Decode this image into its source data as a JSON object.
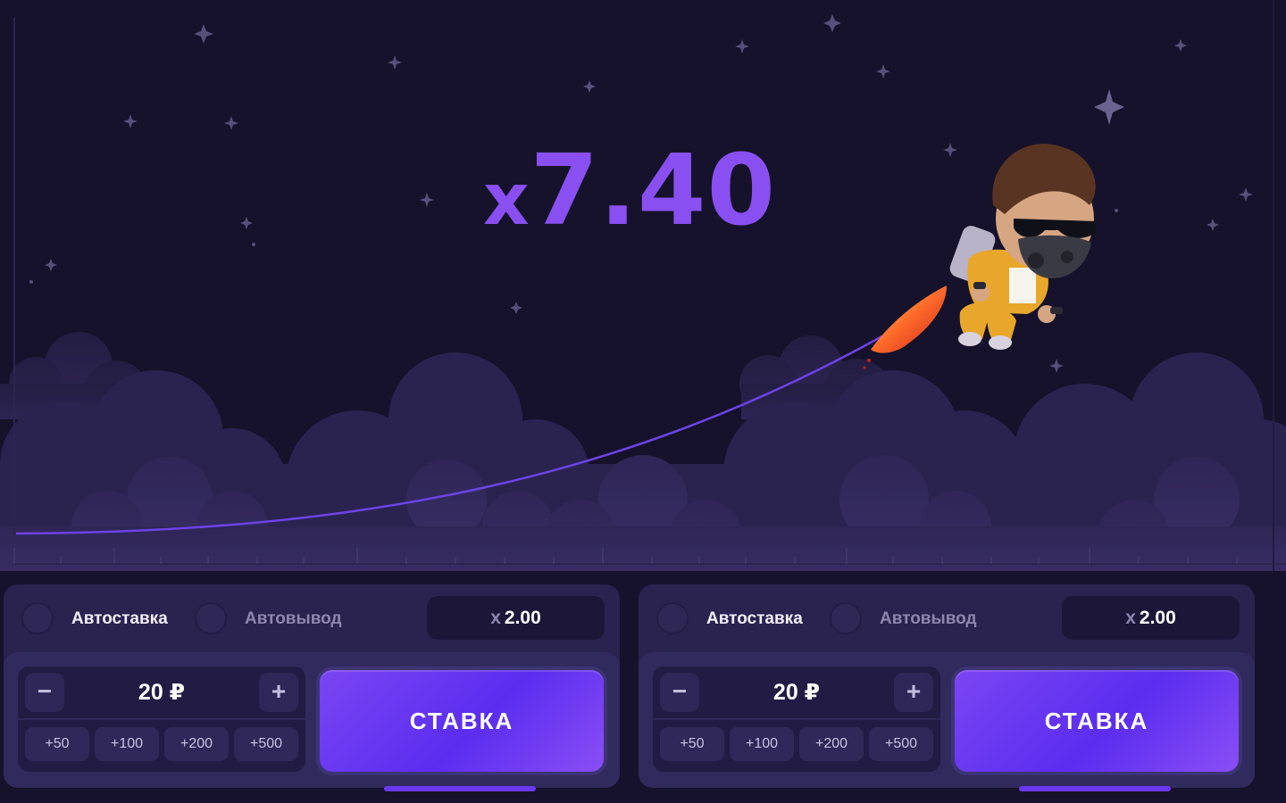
{
  "game": {
    "multiplier_prefix": "x",
    "multiplier_value": "7.40",
    "accent_color": "#8a4ff0",
    "curve_color": "#6b44e8",
    "background_color": "#16122b",
    "character_icon": "jetpack-pilot-icon"
  },
  "panels": [
    {
      "autobet_label": "Автоставка",
      "autocashout_label": "Автовывод",
      "cashout_prefix": "x",
      "cashout_value": "2.00",
      "stake_value": "20 ₽",
      "minus_symbol": "−",
      "plus_symbol": "+",
      "quick_amounts": [
        "+50",
        "+100",
        "+200",
        "+500"
      ],
      "bet_label": "СТАВКА"
    },
    {
      "autobet_label": "Автоставка",
      "autocashout_label": "Автовывод",
      "cashout_prefix": "x",
      "cashout_value": "2.00",
      "stake_value": "20 ₽",
      "minus_symbol": "−",
      "plus_symbol": "+",
      "quick_amounts": [
        "+50",
        "+100",
        "+200",
        "+500"
      ],
      "bet_label": "СТАВКА"
    }
  ]
}
